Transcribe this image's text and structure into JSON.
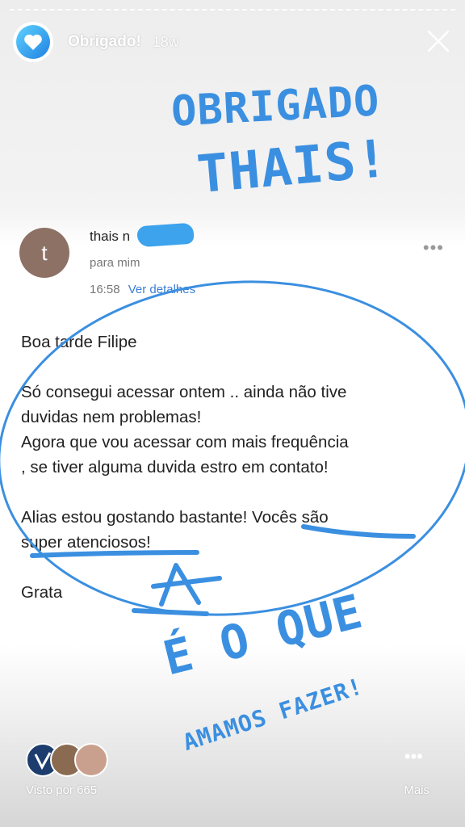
{
  "story": {
    "title": "Obrigado!",
    "age": "18w",
    "avatar_icon": "heart-icon",
    "accent": "#3b8fe0"
  },
  "handwriting": {
    "line1": "OBRIGADO",
    "line2": "THAIS!",
    "line3": "É O QUE",
    "line4": "AMAMOS FAZER!"
  },
  "email": {
    "avatar_letter": "t",
    "sender": "thais n",
    "recipient": "para mim",
    "time": "16:58",
    "details_link": "Ver detalhes",
    "greeting": "Boa tarde Filipe",
    "paragraph1_line1": "Só consegui acessar ontem .. ainda não tive",
    "paragraph1_line2": "duvidas nem problemas!",
    "paragraph1_line3": "Agora que vou acessar com mais frequência",
    "paragraph1_line4": ", se tiver alguma duvida estro em contato!",
    "paragraph2_line1": "Alias estou gostando bastante! Vocês são",
    "paragraph2_line2": "super atenciosos!",
    "signoff": "Grata"
  },
  "footer": {
    "seen_by": "Visto por 665",
    "more_label": "Mais"
  }
}
